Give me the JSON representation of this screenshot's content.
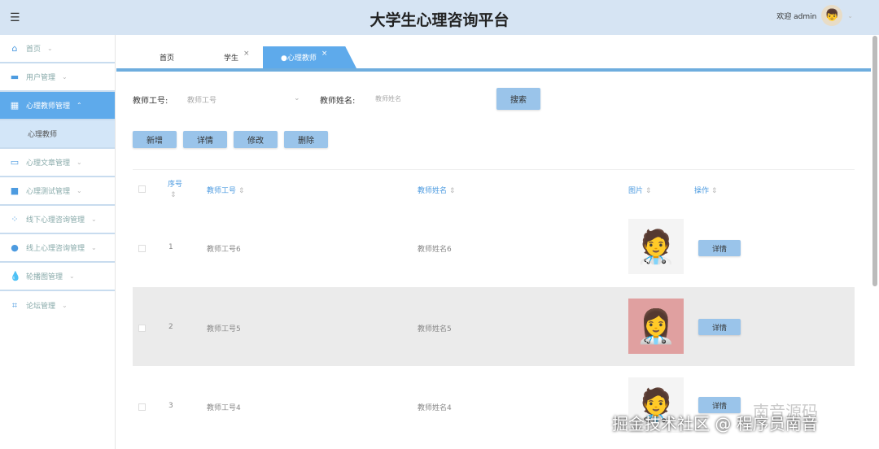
{
  "header": {
    "title": "大学生心理咨询平台",
    "welcome": "欢迎 admin"
  },
  "sidebar": {
    "items": [
      {
        "label": "首页",
        "icon": "home-icon"
      },
      {
        "label": "用户管理",
        "icon": "user-icon"
      },
      {
        "label": "心理教师管理",
        "icon": "grid-icon",
        "active": true
      },
      {
        "label": "心理文章管理",
        "icon": "briefcase-icon"
      },
      {
        "label": "心理测试管理",
        "icon": "book-icon"
      },
      {
        "label": "线下心理咨询管理",
        "icon": "apps-icon"
      },
      {
        "label": "线上心理咨询管理",
        "icon": "chat-icon"
      },
      {
        "label": "轮播图管理",
        "icon": "drop-icon"
      },
      {
        "label": "论坛管理",
        "icon": "crop-icon"
      }
    ],
    "sub_item": "心理教师"
  },
  "tabs": [
    {
      "label": "首页"
    },
    {
      "label": "学生"
    },
    {
      "label": "●心理教师"
    }
  ],
  "search": {
    "id_label": "教师工号:",
    "id_placeholder": "教师工号",
    "name_label": "教师姓名:",
    "name_placeholder": "教师姓名",
    "search_button": "搜索"
  },
  "actions": {
    "add": "新增",
    "detail": "详情",
    "edit": "修改",
    "delete": "删除"
  },
  "table": {
    "headers": {
      "index": "序号",
      "id": "教师工号",
      "name": "教师姓名",
      "image": "图片",
      "op": "操作"
    },
    "rows": [
      {
        "index": "1",
        "id": "教师工号6",
        "name": "教师姓名6",
        "button": "详情"
      },
      {
        "index": "2",
        "id": "教师工号5",
        "name": "教师姓名5",
        "button": "详情"
      },
      {
        "index": "3",
        "id": "教师工号4",
        "name": "教师姓名4",
        "button": "详情"
      }
    ]
  },
  "watermark": {
    "line1": "掘金技术社区 @ 程序员南音",
    "line2": "南音源码"
  }
}
